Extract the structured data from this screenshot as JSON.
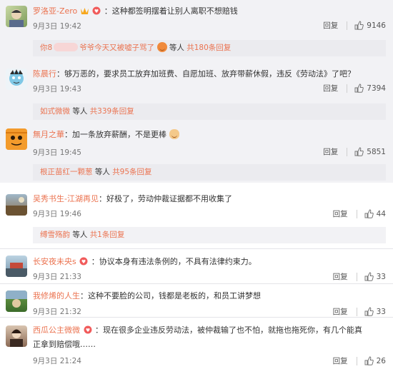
{
  "actions": {
    "reply_label": "回复"
  },
  "panel_a": {
    "comments": [
      {
        "username": "罗洛亚-Zero",
        "text": "：这种都签明摆着让别人离职不想赔钱",
        "time": "9月3日 19:42",
        "likes": "9146",
        "sub": {
          "user_prefix": "你8",
          "user_suffix": "爷爷今天又被嘘子骂了",
          "suffix": "等人",
          "count": "共180条回复"
        }
      },
      {
        "username": "陈晨行",
        "text": "：够万恶的，要求员工放弃加班费、自愿加班、放弃带薪休假，违反《劳动法》了吧？",
        "time": "9月3日 19:43",
        "likes": "7394",
        "sub": {
          "user": "如式微微",
          "suffix": "等人",
          "count": "共339条回复"
        }
      },
      {
        "username": "無月之華",
        "text": "：加一条放弃薪酬，不是更棒",
        "time": "9月3日 19:45",
        "likes": "5851",
        "sub": {
          "user": "根正苗红一颗葱",
          "suffix": "等人",
          "count": "共95条回复"
        }
      }
    ]
  },
  "panel_b": {
    "comments": [
      {
        "username": "吴秀书生-江湖再见",
        "text": "：好极了，劳动仲裁证据都不用收集了",
        "time": "9月3日 19:46",
        "likes": "44",
        "sub": {
          "user": "缚雪殇韵",
          "suffix": "等人",
          "count": "共1条回复"
        }
      },
      {
        "username": "长安夜未央s",
        "text": "：协议本身有违法条例的，不具有法律约束力。",
        "time": "9月3日 21:33",
        "likes": "33"
      },
      {
        "username": "我修烯的人生",
        "text": "：这种不要脸的公司，钱都是老板的，和员工讲梦想",
        "time": "9月3日 21:32",
        "likes": "33"
      },
      {
        "username": "西瓜公主微微",
        "text": "：现在很多企业违反劳动法，被仲裁输了也不怕，就拖也拖死你，有几个能真",
        "text2": "正拿到赔偿哦……",
        "time": "9月3日 21:24",
        "likes": "26"
      }
    ]
  },
  "colors": {
    "username": "#eb7350",
    "text": "#333333",
    "time": "#777777",
    "panel_bg": "#f2f2f5"
  },
  "icons": [
    "vip-crown-icon",
    "fan-badge-icon",
    "thumbs-up-icon",
    "emoji-icon"
  ]
}
